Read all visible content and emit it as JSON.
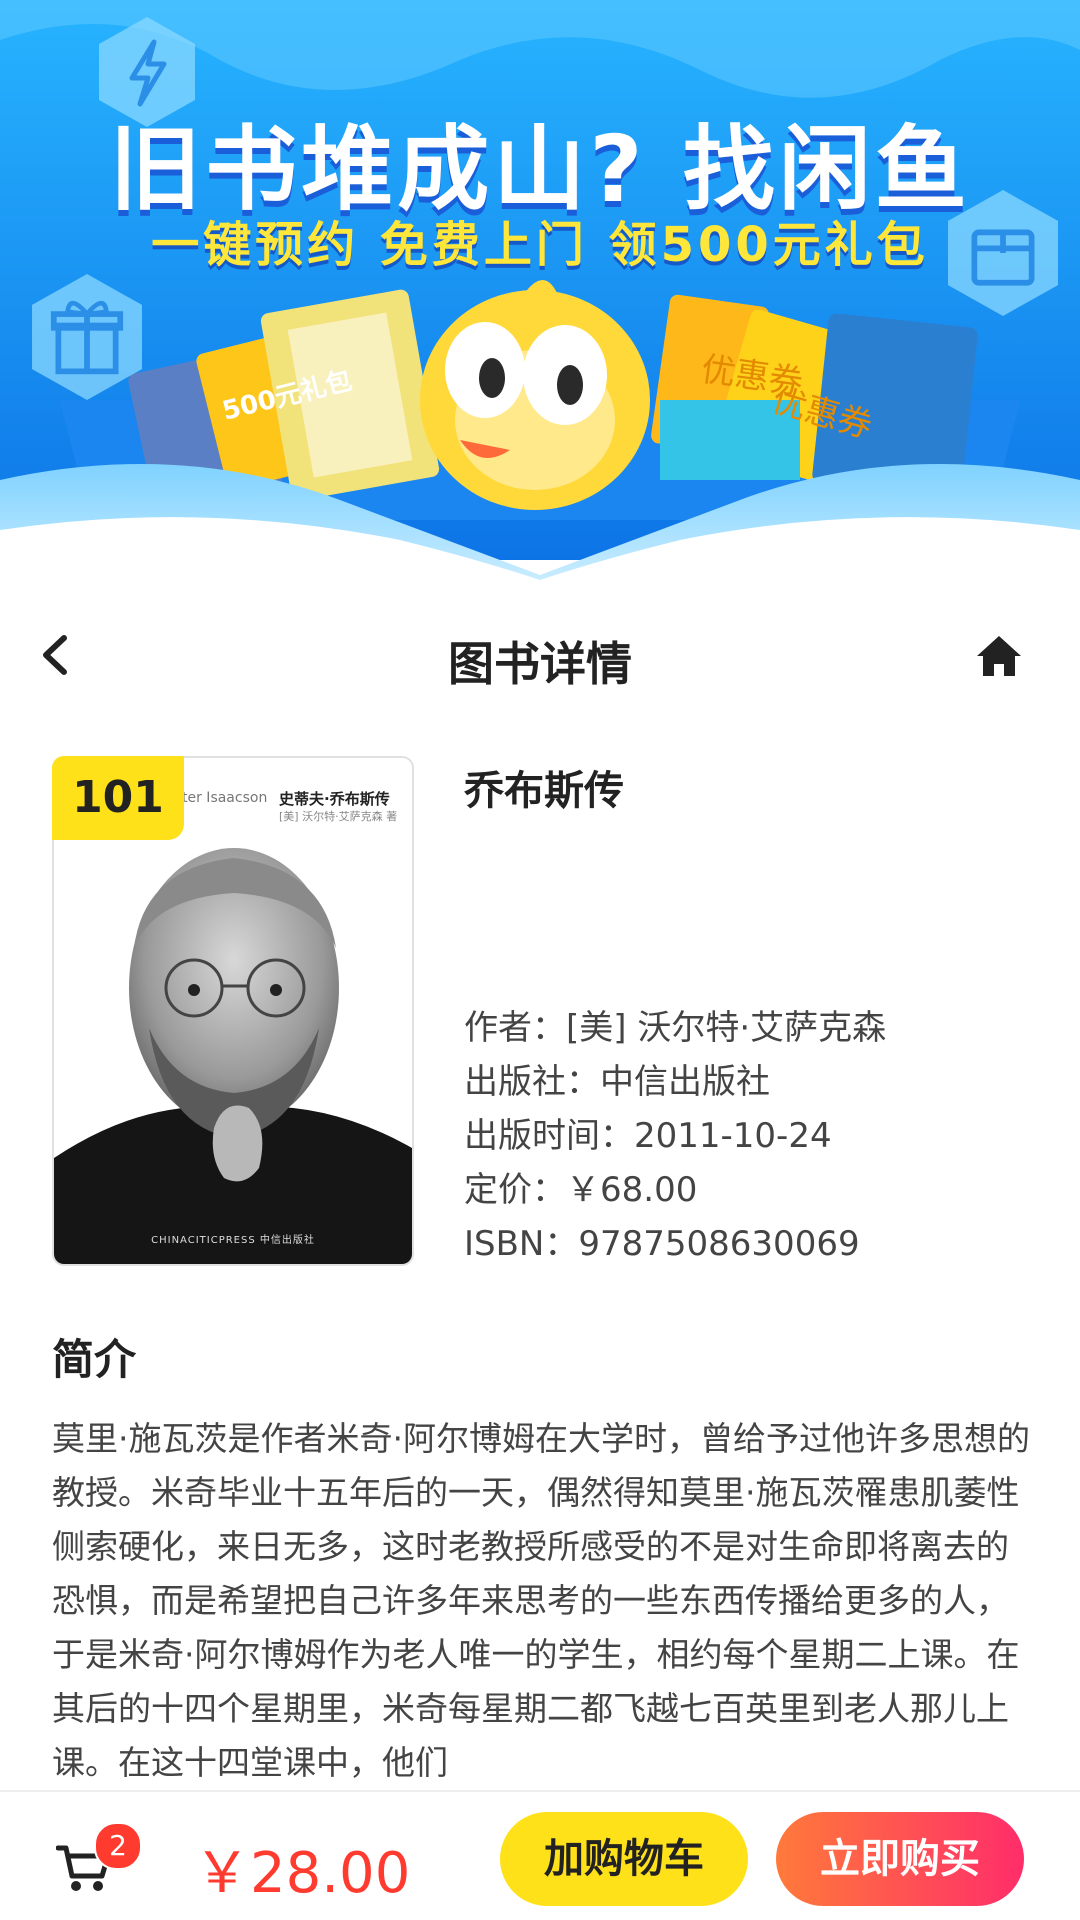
{
  "banner": {
    "title": "旧书堆成山? 找闲鱼",
    "subtitle": "一键预约  免费上门  领500元礼包",
    "coupon_text": "优惠券",
    "gift_pack_text": "500元礼包",
    "colors": {
      "bg_top": "#1aa9ff",
      "bg_bottom": "#0e7be8",
      "accent": "#ffe63a"
    }
  },
  "header": {
    "title": "图书详情",
    "back_icon": "chevron-left-icon",
    "home_icon": "home-icon"
  },
  "book": {
    "rank": "101",
    "title": "乔布斯传",
    "cover": {
      "author_en": "ter Isaacson",
      "title_cn": "史蒂夫·乔布斯传",
      "author_cn": "[美] 沃尔特·艾萨克森 著",
      "publisher_mark": "CHINACITICPRESS 中信出版社"
    },
    "meta": [
      {
        "label": "作者：",
        "value": "[美] 沃尔特·艾萨克森"
      },
      {
        "label": "出版社：",
        "value": "中信出版社"
      },
      {
        "label": "出版时间：",
        "value": "2011-10-24"
      },
      {
        "label": "定价：",
        "value": "￥68.00"
      },
      {
        "label": "ISBN：",
        "value": "9787508630069"
      }
    ]
  },
  "intro": {
    "heading": "简介",
    "text": "莫里·施瓦茨是作者米奇·阿尔博姆在大学时，曾给予过他许多思想的教授。米奇毕业十五年后的一天，偶然得知莫里·施瓦茨罹患肌萎性侧索硬化，来日无多，这时老教授所感受的不是对生命即将离去的恐惧，而是希望把自己许多年来思考的一些东西传播给更多的人，于是米奇·阿尔博姆作为老人唯一的学生，相约每个星期二上课。在其后的十四个星期里，米奇每星期二都飞越七百英里到老人那儿上课。在这十四堂课中，他们"
  },
  "bottom": {
    "cart_count": "2",
    "price": "￥28.00",
    "add_to_cart": "加购物车",
    "buy_now": "立即购买",
    "colors": {
      "price": "#ff3b30",
      "cart_btn": "#ffe11a",
      "buy_btn_start": "#ff7a3a",
      "buy_btn_end": "#ff2d6a"
    }
  }
}
